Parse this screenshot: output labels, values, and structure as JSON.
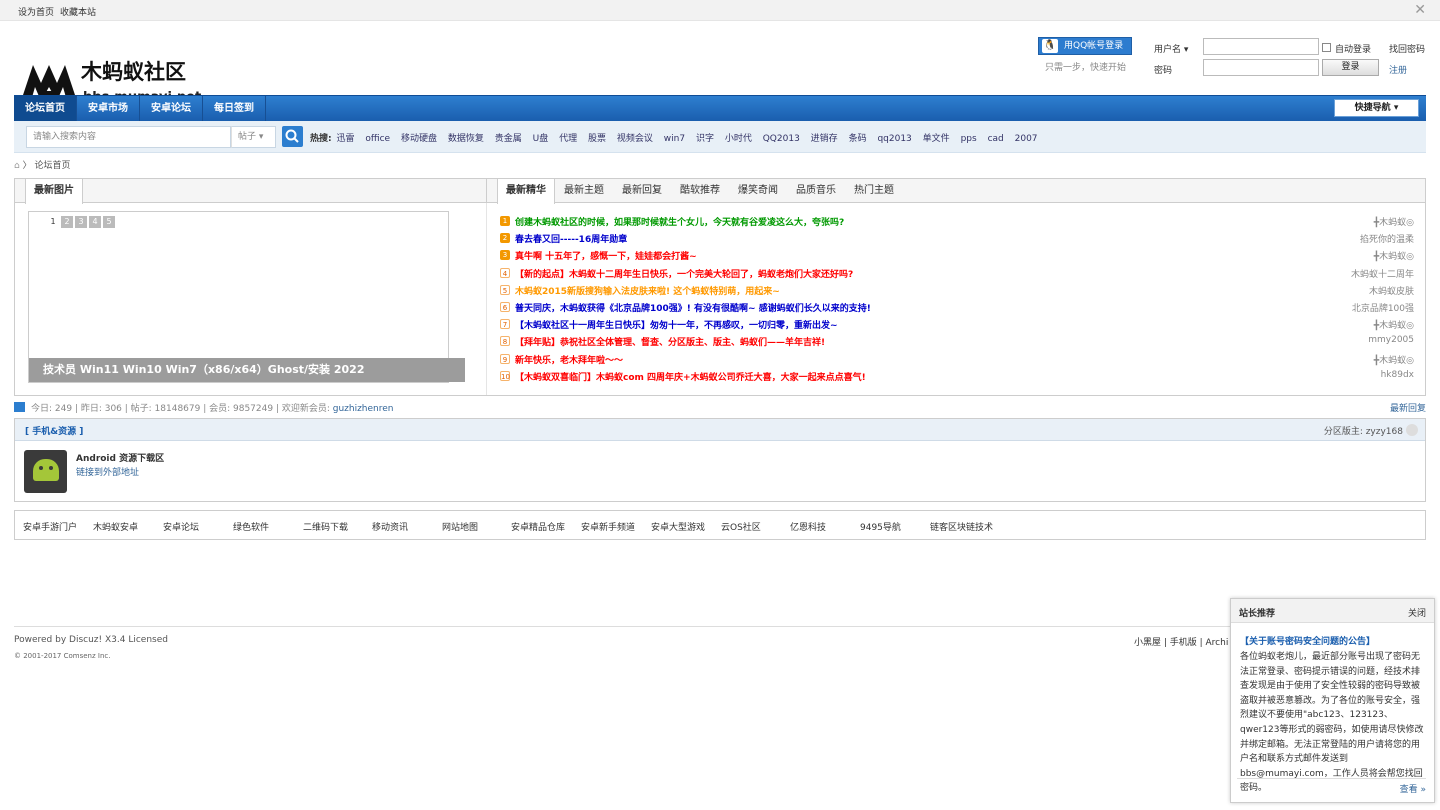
{
  "topbar": {
    "set_home": "设为首页",
    "bookmark": "收藏本站",
    "close": "✕"
  },
  "logo": {
    "cn": "木蚂蚁社区",
    "url": "bbs.mumayi.net"
  },
  "login": {
    "qq_btn": "用QQ帐号登录",
    "tagline": "只需一步，快速开始",
    "username_label": "用户名",
    "password_label": "密码",
    "auto_login": "自动登录",
    "login_btn": "登录",
    "find_pwd": "找回密码",
    "register": "注册"
  },
  "nav": {
    "items": [
      "论坛首页",
      "安卓市场",
      "安卓论坛",
      "每日签到"
    ],
    "quick": "快捷导航"
  },
  "search": {
    "placeholder": "请输入搜索内容",
    "type": "帖子",
    "hot_label": "热搜:",
    "hot": [
      "迅雷",
      "office",
      "移动硬盘",
      "数据恢复",
      "贵金属",
      "U盘",
      "代理",
      "股票",
      "视频会议",
      "win7",
      "识字",
      "小时代",
      "QQ2013",
      "进销存",
      "条码",
      "qq2013",
      "单文件",
      "pps",
      "cad",
      "2007"
    ]
  },
  "breadcrumb": "论坛首页",
  "left_tab": "最新图片",
  "slide": {
    "nums": [
      "1",
      "2",
      "3",
      "4",
      "5"
    ],
    "caption": "技术员 Win11 Win10 Win7（x86/x64）Ghost/安装 2022"
  },
  "tabs": [
    "最新精华",
    "最新主题",
    "最新回复",
    "酷软推荐",
    "爆笑奇闻",
    "品质音乐",
    "热门主题"
  ],
  "threads": [
    {
      "n": "1",
      "title": "创建木蚂蚁社区的时候，如果那时候就生个女儿，今天就有谷爱凌这么大，夸张吗?",
      "author": "╋木蚂蚁◎",
      "color": "#009900"
    },
    {
      "n": "2",
      "title": "春去春又回-----16周年勋章",
      "author": "掐死你的温柔",
      "color": "#0000cc"
    },
    {
      "n": "3",
      "title": "真牛啊 十五年了，感慨一下，娃娃都会打酱~",
      "author": "╋木蚂蚁◎",
      "color": "#ff0000"
    },
    {
      "n": "4",
      "title": "【新的起点】木蚂蚁十二周年生日快乐，一个完美大轮回了，蚂蚁老炮们大家还好吗?",
      "author": "木蚂蚁十二周年",
      "color": "#ff0000"
    },
    {
      "n": "5",
      "title": "木蚂蚁2015新版搜狗输入法皮肤来啦! 这个蚂蚁特别萌，用起来~",
      "author": "木蚂蚁皮肤",
      "color": "#ff9900"
    },
    {
      "n": "6",
      "title": "普天同庆，木蚂蚁获得《北京品牌100强》! 有没有很酷啊~ 感谢蚂蚁们长久以来的支持!",
      "author": "北京品牌100强",
      "color": "#0000cc"
    },
    {
      "n": "7",
      "title": "【木蚂蚁社区十一周年生日快乐】匆匆十一年，不再感叹，一切归零，重新出发~",
      "author": "╋木蚂蚁◎",
      "color": "#0000cc"
    },
    {
      "n": "8",
      "title": "【拜年贴】恭祝社区全体管理、督查、分区版主、版主、蚂蚁们——羊年吉祥!",
      "author": "mmy2005",
      "color": "#ff0000"
    },
    {
      "n": "9",
      "title": "新年快乐，老木拜年啦～～",
      "author": "╋木蚂蚁◎",
      "color": "#ff0000"
    },
    {
      "n": "10",
      "title": "【木蚂蚁双喜临门】木蚂蚁com 四周年庆+木蚂蚁公司乔迁大喜，大家一起来点点喜气!",
      "author": "hk89dx",
      "color": "#ff0000"
    }
  ],
  "stats": {
    "text": "今日: 249 | 昨日: 306 | 帖子: 18148679 | 会员: 9857249 | 欢迎新会员: ",
    "new_member": "guzhizhenren",
    "latest": "最新回复"
  },
  "forum": {
    "title": "[ 手机&资源 ]",
    "moderator": "分区版主: zyzy168",
    "name": "Android 资源下载区",
    "link": "链接到外部地址"
  },
  "links": [
    "安卓手游门户",
    "木蚂蚁安卓",
    "安卓论坛",
    "绿色软件",
    "二维码下载",
    "移动资讯",
    "网站地图",
    "安卓精品仓库",
    "安卓新手频道",
    "安卓大型游戏",
    "云OS社区",
    "亿恩科技",
    "9495导航",
    "链客区块链技术"
  ],
  "footer": {
    "powered": "Powered by Discuz! X3.4 Licensed",
    "copyright": "© 2001-2017 Comsenz Inc.",
    "links": "小黑屋 | 手机版 | Archi"
  },
  "popup": {
    "title": "站长推荐",
    "close": "关闭",
    "headline": "【关于账号密码安全问题的公告】",
    "body": "各位蚂蚁老炮儿，最近部分账号出现了密码无法正常登录、密码提示错误的问题，经技术排查发现是由于使用了安全性较弱的密码导致被盗取并被恶意篡改。为了各位的账号安全，强烈建议不要使用\"abc123、123123、qwer123等形式的弱密码，如使用请尽快修改并绑定邮箱。无法正常登陆的用户请将您的用户名和联系方式邮件发送到bbs@mumayi.com，工作人员将会帮您找回密码。",
    "more": "查看 »"
  }
}
